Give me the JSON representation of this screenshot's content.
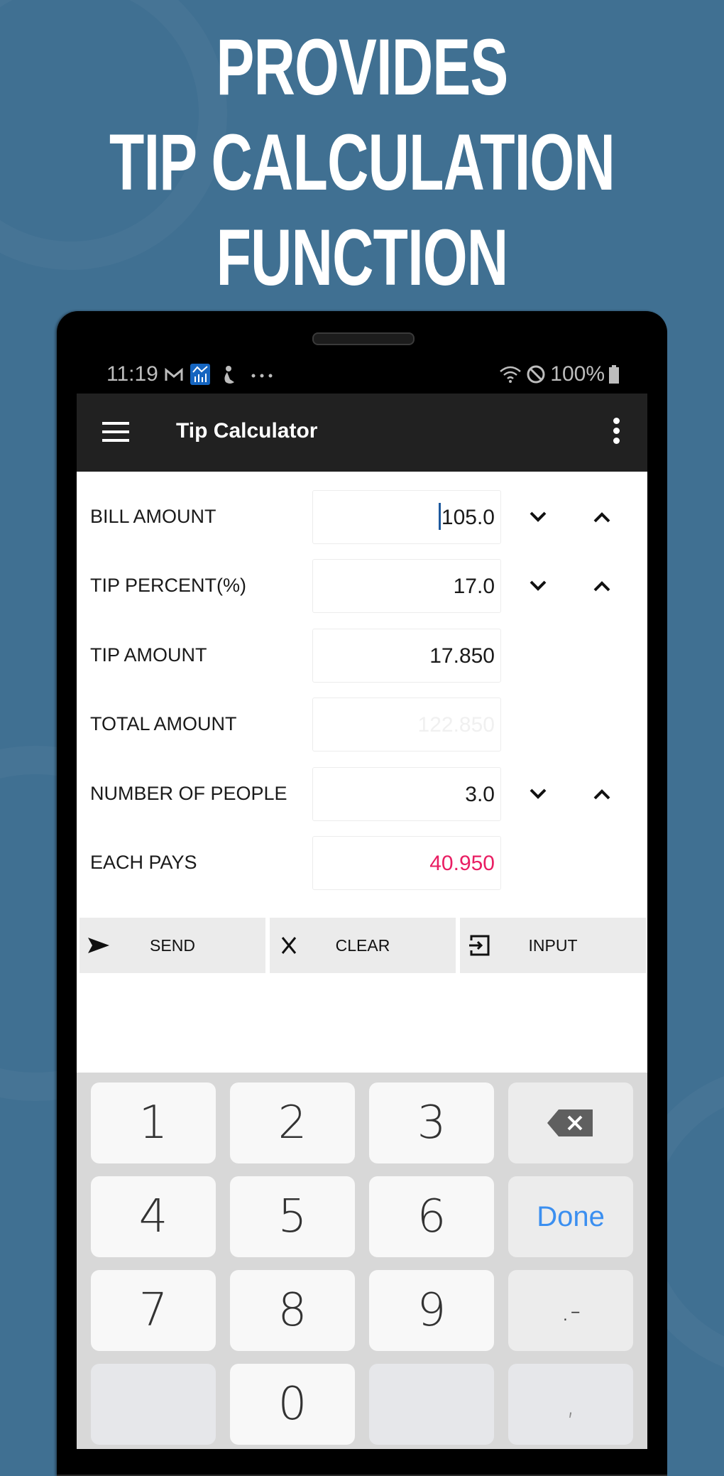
{
  "promo": {
    "headline_lines": [
      "PROVIDES",
      "TIP CALCULATION",
      "FUNCTION"
    ],
    "background_color": "#407092"
  },
  "status_bar": {
    "time": "11:19",
    "notification_icons": [
      "gmail-icon",
      "chart-app-icon",
      "figure-icon",
      "more-notifications-icon"
    ],
    "battery": "100%",
    "system_icons": [
      "wifi-icon",
      "do-not-disturb-icon",
      "battery-icon"
    ]
  },
  "app_bar": {
    "title": "Tip Calculator",
    "menu_icon": "hamburger-icon",
    "overflow_icon": "more-vert-icon"
  },
  "form": {
    "rows": [
      {
        "label": "BILL AMOUNT",
        "value": "105.0",
        "stepper": true,
        "focused": true,
        "state": "normal"
      },
      {
        "label": "TIP PERCENT(%)",
        "value": "17.0",
        "stepper": true,
        "focused": false,
        "state": "normal"
      },
      {
        "label": "TIP AMOUNT",
        "value": "17.850",
        "stepper": false,
        "focused": false,
        "state": "normal"
      },
      {
        "label": "TOTAL AMOUNT",
        "value": "122.850",
        "stepper": false,
        "focused": false,
        "state": "disabled"
      },
      {
        "label": "NUMBER OF PEOPLE",
        "value": "3.0",
        "stepper": true,
        "focused": false,
        "state": "normal"
      },
      {
        "label": "EACH PAYS",
        "value": "40.950",
        "stepper": false,
        "focused": false,
        "state": "highlight"
      }
    ],
    "highlight_color": "#e91e63"
  },
  "actions": [
    {
      "label": "SEND",
      "icon": "send-icon"
    },
    {
      "label": "CLEAR",
      "icon": "close-icon"
    },
    {
      "label": "INPUT",
      "icon": "input-icon"
    }
  ],
  "keyboard": {
    "rows": [
      [
        "1",
        "2",
        "3",
        "⌫"
      ],
      [
        "4",
        "5",
        "6",
        "Done"
      ],
      [
        "7",
        "8",
        "9",
        ".-"
      ],
      [
        "",
        "0",
        "",
        ","
      ]
    ],
    "done_color": "#3b8ff0"
  }
}
